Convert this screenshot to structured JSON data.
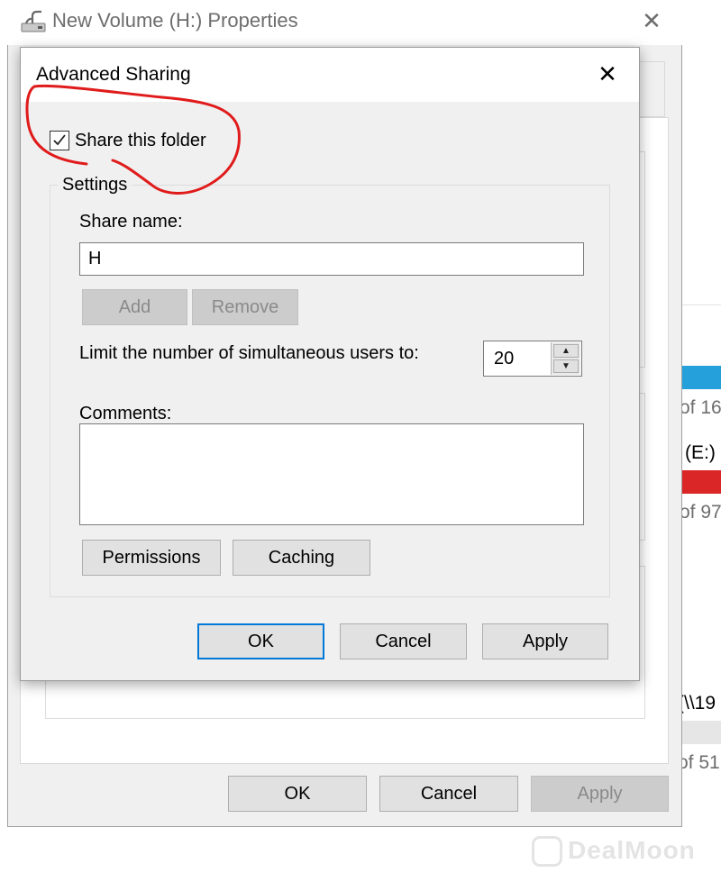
{
  "background_window": {
    "texts": [
      "of 16",
      "(E:)",
      "of 97",
      "(\\\\19",
      "of 51"
    ],
    "colors": {
      "blue_bar": "#26a0da",
      "red_bar": "#da2626"
    }
  },
  "properties_window": {
    "title": "New Volume (H:) Properties",
    "icon": "drive-icon",
    "close_glyph": "✕",
    "buttons": {
      "ok": "OK",
      "cancel": "Cancel",
      "apply": "Apply"
    }
  },
  "advanced_sharing": {
    "title": "Advanced Sharing",
    "close_glyph": "✕",
    "share_checkbox": {
      "label": "Share this folder",
      "checked": true
    },
    "settings": {
      "legend": "Settings",
      "share_name_label": "Share name:",
      "share_name_value": "H",
      "add_label": "Add",
      "remove_label": "Remove",
      "limit_label": "Limit the number of simultaneous users to:",
      "limit_value": "20",
      "comments_label": "Comments:",
      "comments_value": "",
      "permissions_label": "Permissions",
      "caching_label": "Caching"
    },
    "buttons": {
      "ok": "OK",
      "cancel": "Cancel",
      "apply": "Apply"
    }
  },
  "annotation": {
    "color": "#e01b1b",
    "shape": "freehand-circle"
  },
  "watermark": {
    "text": "DealMoon"
  }
}
